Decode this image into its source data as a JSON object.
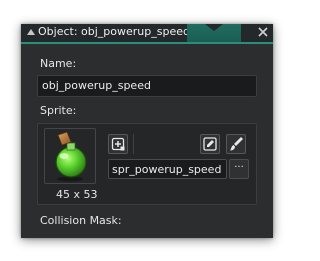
{
  "window": {
    "title": "Object: obj_powerup_speed",
    "close_symbol": "×",
    "accent_color": "#2a8f7a"
  },
  "name_section": {
    "label": "Name:",
    "value": "obj_powerup_speed"
  },
  "sprite_section": {
    "label": "Sprite:",
    "thumbnail_size": "45 x 53",
    "sprite_name": "spr_powerup_speed",
    "browse_label": "···",
    "icons": [
      "new-sprite-icon",
      "edit-sprite-icon",
      "paint-brush-icon"
    ],
    "thumbnail_icon": "green-potion-icon"
  },
  "collision_section": {
    "label": "Collision Mask:"
  }
}
